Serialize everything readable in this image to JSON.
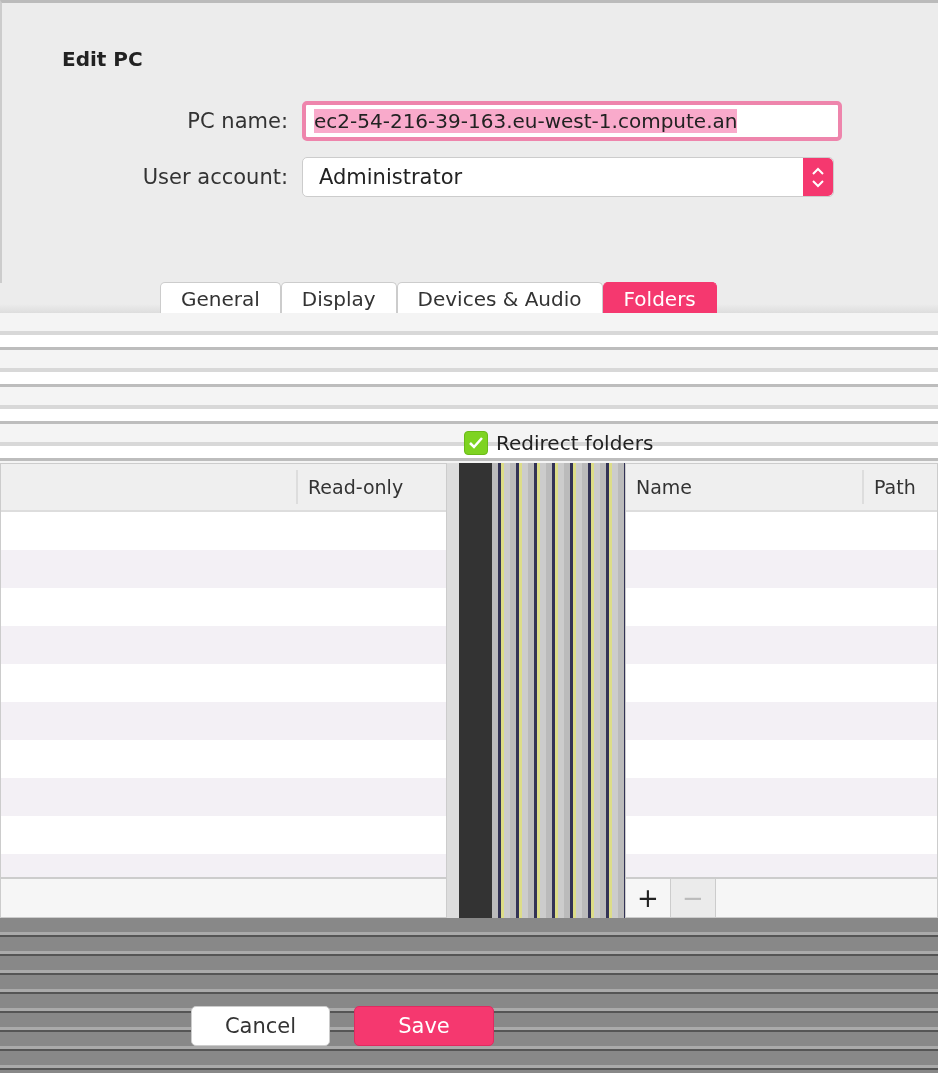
{
  "dialog": {
    "title": "Edit PC"
  },
  "form": {
    "pc_name_label": "PC name:",
    "pc_name": "ec2-54-216-39-163.eu-west-1.compute.an",
    "user_account_label": "User account:",
    "user_account": "Administrator"
  },
  "tabs": [
    {
      "label": "General",
      "selected": false
    },
    {
      "label": "Display",
      "selected": false
    },
    {
      "label": "Devices & Audio",
      "selected": false
    },
    {
      "label": "Folders",
      "selected": true
    }
  ],
  "redirect": {
    "label": "Redirect folders",
    "checked": true
  },
  "left_table": {
    "columns": [
      "Read-only"
    ]
  },
  "right_table": {
    "columns": [
      "Name",
      "Path"
    ],
    "add": "+",
    "remove": "−"
  },
  "buttons": [
    {
      "label": "Cancel",
      "kind": "secondary"
    },
    {
      "label": "Save",
      "kind": "primary"
    }
  ]
}
